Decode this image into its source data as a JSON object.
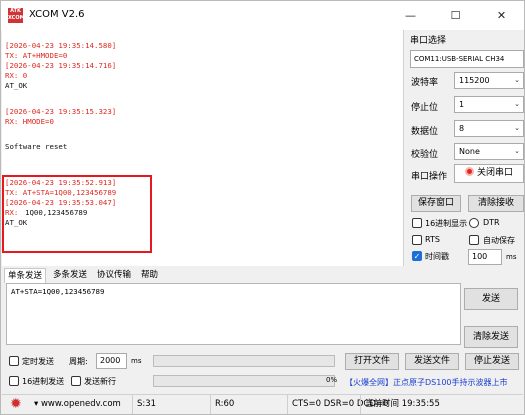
{
  "window": {
    "title": "XCOM V2.6",
    "icon_text": "ATK XCOM",
    "min_icon": "—",
    "max_icon": "☐",
    "close_icon": "✕"
  },
  "receive": {
    "lines": [
      {
        "text": "[2026-04-23 19:35:14.580]",
        "color": "red"
      },
      {
        "text": "TX: AT+HMODE=0",
        "color": "red"
      },
      {
        "text": "[2026-04-23 19:35:14.716]",
        "color": "red"
      },
      {
        "text": "RX: 0",
        "color": "red"
      },
      {
        "text": "AT_OK",
        "color": "dark"
      },
      {
        "text": "[2026-04-23 19:35:15.323]",
        "color": "red"
      },
      {
        "text": "RX: HMODE=0",
        "color": "red"
      },
      {
        "text": "Software reset",
        "color": "dark"
      },
      {
        "text": "[2026-04-23 19:35:52.913]",
        "color": "red"
      },
      {
        "text": "TX: AT+STA=1Q00,123456789",
        "color": "red"
      },
      {
        "text": "[2026-04-23 19:35:53.047]",
        "color": "red"
      },
      {
        "text": "RX: ",
        "color": "red"
      },
      {
        "text": "1Q00,123456789",
        "color": "dark"
      },
      {
        "text": "AT_OK",
        "color": "dark"
      }
    ]
  },
  "settings": {
    "section_title": "串口选择",
    "port": "COM11:USB-SERIAL CH34",
    "baud_label": "波特率",
    "baud_value": "115200",
    "stopbits_label": "停止位",
    "stopbits_value": "1",
    "databits_label": "数据位",
    "databits_value": "8",
    "parity_label": "校验位",
    "parity_value": "None",
    "operation_label": "串口操作",
    "open_button": "关闭串口",
    "save_window_button": "保存窗口",
    "clear_receive_button": "清除接收",
    "hex_display_label": "16进制显示",
    "dtr_label": "DTR",
    "rts_label": "RTS",
    "auto_save_label": "自动保存",
    "timestamp_label": "时间戳",
    "timestamp_checked": true,
    "interval_value": "100",
    "interval_unit": "ms"
  },
  "tabs": [
    "单条发送",
    "多条发送",
    "协议传输",
    "帮助"
  ],
  "send": {
    "text": "AT+STA=1Q00,123456789",
    "send_button": "发送",
    "clear_send_button": "清除发送",
    "timed_send_label": "定时发送",
    "period_label": "周期:",
    "period_value": "2000",
    "period_unit": "ms",
    "hex_send_label": "16进制发送",
    "newline_label": "发送新行",
    "open_file_button": "打开文件",
    "send_file_button": "发送文件",
    "stop_send_button": "停止发送",
    "progress_percent": "0%",
    "progress_fraction": 0,
    "ad_text": "【火爆全网】正点原子DS100手持示波器上市"
  },
  "status": {
    "url": "www.openedv.com",
    "sent": "S:31",
    "received": "R:60",
    "signals": "CTS=0 DSR=0 DCD=0",
    "time": "当前时间 19:35:55"
  },
  "colors": {
    "log_red": "#e0281f",
    "highlight_border": "#e8191e",
    "checkbox_blue": "#1a6fd8",
    "link_blue": "#1a3fd1"
  }
}
